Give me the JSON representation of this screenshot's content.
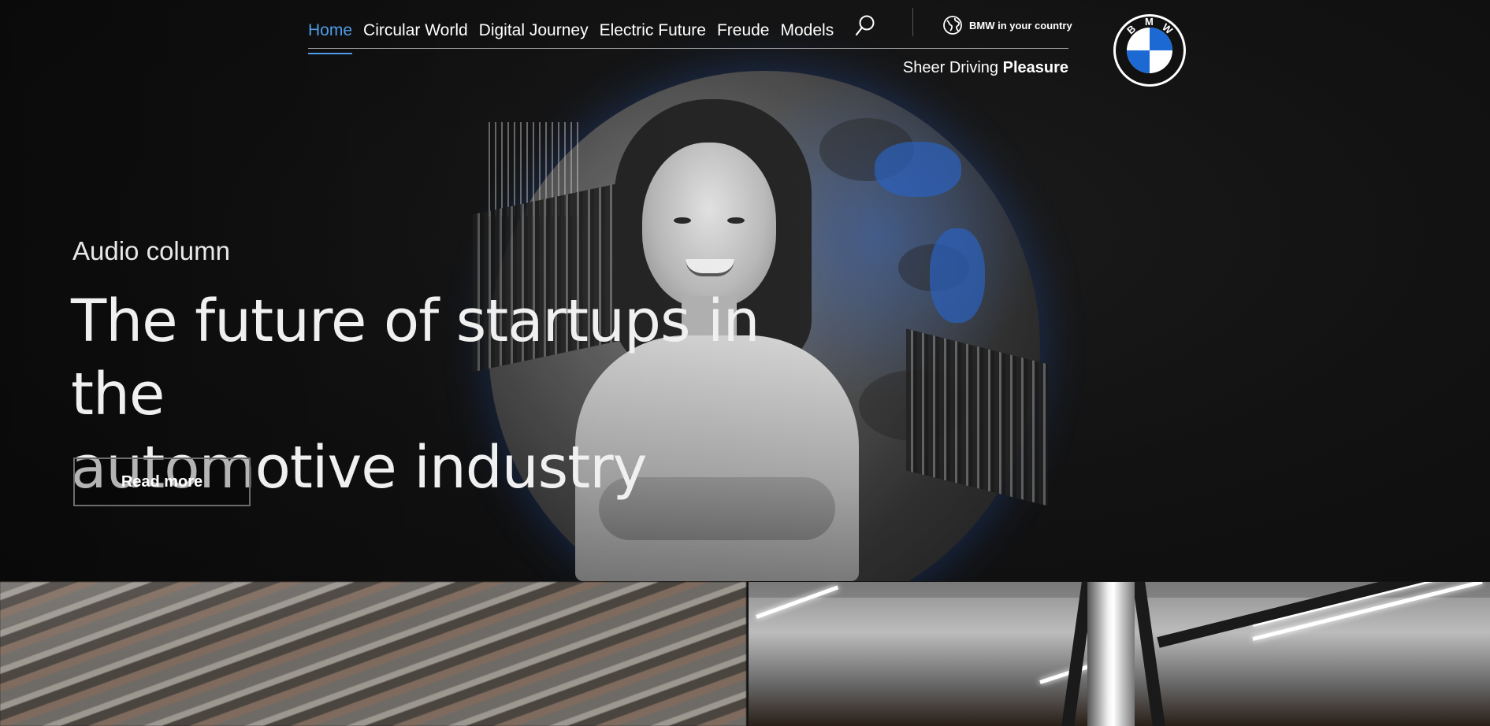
{
  "nav": {
    "items": [
      {
        "label": "Home",
        "active": true
      },
      {
        "label": "Circular World",
        "active": false
      },
      {
        "label": "Digital Journey",
        "active": false
      },
      {
        "label": "Electric Future",
        "active": false
      },
      {
        "label": "Freude",
        "active": false
      },
      {
        "label": "Models",
        "active": false
      }
    ],
    "search_icon": "search-icon",
    "country_label": "BMW in your country",
    "country_icon": "globe-icon"
  },
  "tagline": {
    "regular": "Sheer Driving ",
    "bold": "Pleasure"
  },
  "logo": {
    "letters": [
      "B",
      "M",
      "W"
    ],
    "colors": {
      "blue": "#1c69d4",
      "white": "#ffffff",
      "ring": "#ffffff"
    }
  },
  "hero": {
    "eyebrow": "Audio column",
    "headline_line1": "The future of startups in the",
    "headline_line2": "automotive industry",
    "cta_label": "Read more"
  },
  "colors": {
    "accent": "#4f9be8",
    "background": "#141414"
  }
}
